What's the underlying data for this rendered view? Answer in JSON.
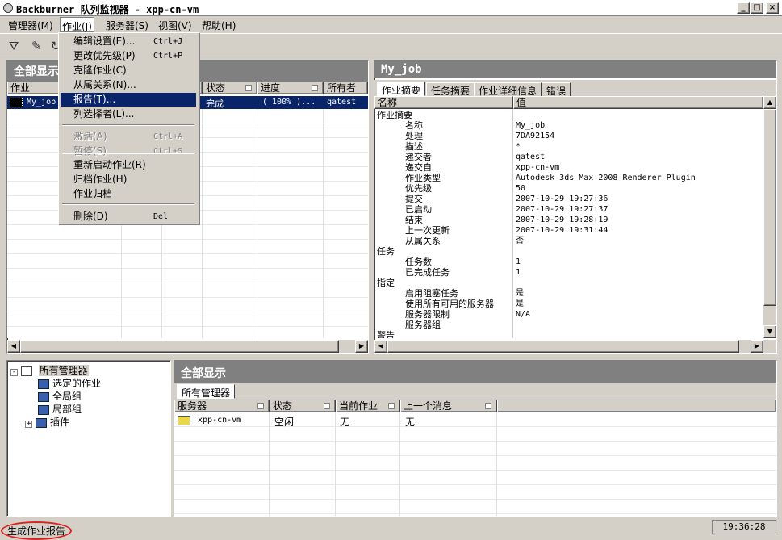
{
  "window": {
    "title": "Backburner 队列监视器 - xpp-cn-vm"
  },
  "menu": [
    "管理器(M)",
    "作业(J)",
    "服务器(S)",
    "视图(V)",
    "帮助(H)"
  ],
  "job_panel": {
    "title": "全部显示",
    "columns": [
      "作业",
      "状态",
      "进度",
      "所有者"
    ],
    "row": {
      "name": "My_job",
      "status": "完成",
      "progress": "( 100% )...",
      "owner": "qatest"
    }
  },
  "dropdown": {
    "items": [
      {
        "label": "编辑设置(E)...",
        "shortcut": "Ctrl+J",
        "enabled": true
      },
      {
        "label": "更改优先级(P)",
        "shortcut": "Ctrl+P",
        "enabled": true
      },
      {
        "label": "克隆作业(C)",
        "shortcut": "",
        "enabled": true
      },
      {
        "label": "从属关系(N)...",
        "shortcut": "",
        "enabled": true
      },
      {
        "label": "报告(T)...",
        "shortcut": "",
        "enabled": true,
        "highlighted": true
      },
      {
        "label": "列选择者(L)...",
        "shortcut": "",
        "enabled": true
      },
      {
        "label": "激活(A)",
        "shortcut": "Ctrl+A",
        "enabled": false
      },
      {
        "label": "暂停(S)",
        "shortcut": "Ctrl+S",
        "enabled": false
      },
      {
        "label": "重新启动作业(R)",
        "shortcut": "",
        "enabled": true
      },
      {
        "label": "归档作业(H)",
        "shortcut": "",
        "enabled": true
      },
      {
        "label": "作业归档",
        "shortcut": "",
        "enabled": true
      },
      {
        "label": "删除(D)",
        "shortcut": "Del",
        "enabled": true
      }
    ]
  },
  "detail_panel": {
    "title": "My_job",
    "tabs": [
      "作业摘要",
      "任务摘要",
      "作业详细信息",
      "错误"
    ],
    "columns": [
      "名称",
      "值"
    ],
    "rows": [
      {
        "k": "作业摘要",
        "v": "",
        "indent": 0
      },
      {
        "k": "名称",
        "v": "My_job",
        "indent": 1
      },
      {
        "k": "处理",
        "v": "7DA92154",
        "indent": 1
      },
      {
        "k": "描述",
        "v": "*",
        "indent": 1
      },
      {
        "k": "递交者",
        "v": "qatest",
        "indent": 1
      },
      {
        "k": "递交自",
        "v": "xpp-cn-vm",
        "indent": 1
      },
      {
        "k": "作业类型",
        "v": "Autodesk 3ds Max 2008 Renderer Plugin",
        "indent": 1
      },
      {
        "k": "优先级",
        "v": "50",
        "indent": 1
      },
      {
        "k": "提交",
        "v": "2007-10-29 19:27:36",
        "indent": 1
      },
      {
        "k": "已启动",
        "v": "2007-10-29 19:27:37",
        "indent": 1
      },
      {
        "k": "结束",
        "v": "2007-10-29 19:28:19",
        "indent": 1
      },
      {
        "k": "上一次更新",
        "v": "2007-10-29 19:31:44",
        "indent": 1
      },
      {
        "k": "从属关系",
        "v": "否",
        "indent": 1
      },
      {
        "k": "任务",
        "v": "",
        "indent": 0
      },
      {
        "k": "任务数",
        "v": "1",
        "indent": 1
      },
      {
        "k": "已完成任务",
        "v": "1",
        "indent": 1
      },
      {
        "k": "指定",
        "v": "",
        "indent": 0
      },
      {
        "k": "启用阻塞任务",
        "v": "是",
        "indent": 1
      },
      {
        "k": "使用所有可用的服务器",
        "v": "是",
        "indent": 1
      },
      {
        "k": "服务器限制",
        "v": "N/A",
        "indent": 1
      },
      {
        "k": "服务器组",
        "v": "",
        "indent": 1
      },
      {
        "k": "警告",
        "v": "",
        "indent": 0
      }
    ]
  },
  "tree": {
    "root": "所有管理器",
    "items": [
      "选定的作业",
      "全局组",
      "局部组",
      "插件"
    ]
  },
  "server_panel": {
    "title": "全部显示",
    "tab": "所有管理器",
    "columns": [
      "服务器",
      "状态",
      "当前作业",
      "上一个消息"
    ],
    "row": {
      "server": "xpp-cn-vm",
      "status": "空闲",
      "job": "无",
      "msg": "无"
    }
  },
  "status": {
    "text": "生成作业报告",
    "time": "19:36:28"
  }
}
